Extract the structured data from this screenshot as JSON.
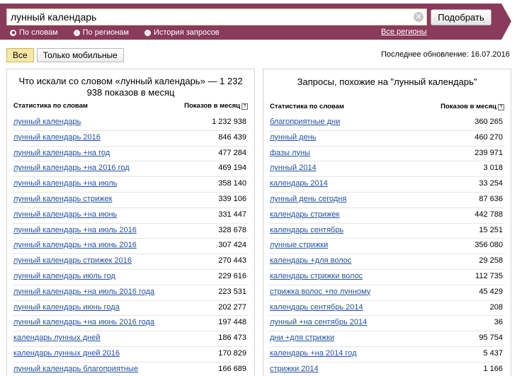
{
  "search": {
    "query": "лунный календарь",
    "submit_label": "Подобрать"
  },
  "modes": [
    {
      "label": "По словам",
      "selected": true
    },
    {
      "label": "По регионам",
      "selected": false
    },
    {
      "label": "История запросов",
      "selected": false
    }
  ],
  "all_regions_label": "Все регионы",
  "filters": {
    "all_label": "Все",
    "mobile_label": "Только мобильные"
  },
  "last_update": "Последнее обновление: 16.07.2016",
  "left_panel": {
    "title": "Что искали со словом «лунный календарь» — 1 232 938 показов в месяц",
    "col_query": "Статистика по словам",
    "col_count": "Показов в месяц",
    "rows": [
      {
        "q": "лунный календарь",
        "n": "1 232 938"
      },
      {
        "q": "лунный календарь 2016",
        "n": "846 439"
      },
      {
        "q": "лунный календарь +на год",
        "n": "477 284"
      },
      {
        "q": "лунный календарь +на 2016 год",
        "n": "469 194"
      },
      {
        "q": "лунный календарь +на июль",
        "n": "358 140"
      },
      {
        "q": "лунный календарь стрижек",
        "n": "339 106"
      },
      {
        "q": "лунный календарь +на июнь",
        "n": "331 447"
      },
      {
        "q": "лунный календарь +на июль 2016",
        "n": "328 678"
      },
      {
        "q": "лунный календарь +на июнь 2016",
        "n": "307 424"
      },
      {
        "q": "лунный календарь стрижек 2016",
        "n": "270 443"
      },
      {
        "q": "лунный календарь июль год",
        "n": "229 616"
      },
      {
        "q": "лунный календарь +на июль 2016 года",
        "n": "223 531"
      },
      {
        "q": "лунный календарь июнь года",
        "n": "202 277"
      },
      {
        "q": "лунный календарь +на июнь 2016 года",
        "n": "197 448"
      },
      {
        "q": "календарь лунных дней",
        "n": "186 473"
      },
      {
        "q": "календарь лунных дней 2016",
        "n": "170 829"
      },
      {
        "q": "лунный календарь благоприятные",
        "n": "166 689"
      }
    ]
  },
  "right_panel": {
    "title": "Запросы, похожие на \"лунный календарь\"",
    "col_query": "Статистика по словам",
    "col_count": "Показов в месяц",
    "rows": [
      {
        "q": "благоприятные дни",
        "n": "360 265"
      },
      {
        "q": "лунный день",
        "n": "460 270"
      },
      {
        "q": "фазы луны",
        "n": "239 971"
      },
      {
        "q": "лунный 2014",
        "n": "3 018"
      },
      {
        "q": "календарь 2014",
        "n": "33 254"
      },
      {
        "q": "лунный день сегодня",
        "n": "87 636"
      },
      {
        "q": "календарь стрижек",
        "n": "442 788"
      },
      {
        "q": "календарь сентябрь",
        "n": "15 251"
      },
      {
        "q": "лунные стрижки",
        "n": "356 080"
      },
      {
        "q": "календарь +для волос",
        "n": "29 258"
      },
      {
        "q": "календарь стрижки волос",
        "n": "112 735"
      },
      {
        "q": "стрижка волос +по лунному",
        "n": "45 429"
      },
      {
        "q": "календарь сентябрь 2014",
        "n": "208"
      },
      {
        "q": "лунный +на сентябрь 2014",
        "n": "36"
      },
      {
        "q": "дни +для стрижки",
        "n": "95 754"
      },
      {
        "q": "календарь +на 2014 год",
        "n": "5 437"
      },
      {
        "q": "стрижки 2014",
        "n": "1 166"
      }
    ]
  },
  "colors": {
    "banner": "#8a3a5b",
    "link": "#2251a0",
    "active_tab": "#f7e7a6"
  }
}
